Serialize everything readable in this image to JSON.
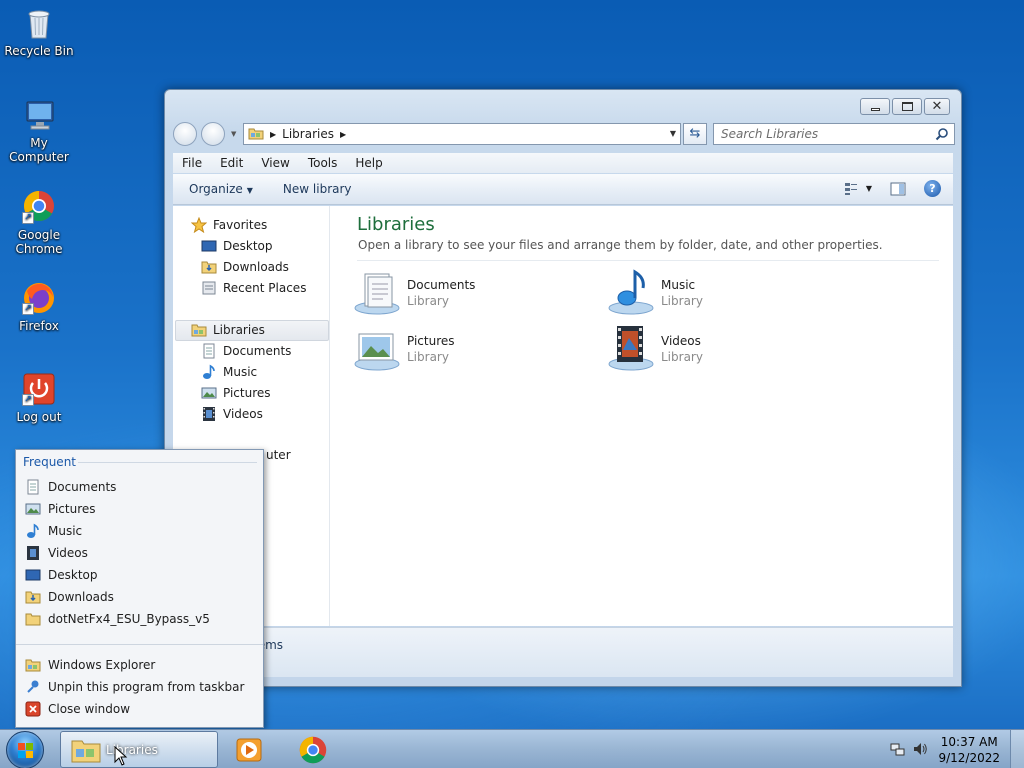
{
  "desktop": {
    "icons": [
      {
        "label": "Recycle Bin",
        "icon": "recycle-bin-icon"
      },
      {
        "label": "My Computer",
        "icon": "computer-icon"
      },
      {
        "label": "Google Chrome",
        "icon": "chrome-icon"
      },
      {
        "label": "Firefox",
        "icon": "firefox-icon"
      },
      {
        "label": "Log out",
        "icon": "log-out-icon"
      }
    ]
  },
  "window": {
    "address": "Libraries",
    "search_placeholder": "Search Libraries",
    "menu": [
      "File",
      "Edit",
      "View",
      "Tools",
      "Help"
    ],
    "toolbar": {
      "organize": "Organize",
      "new_library": "New library"
    },
    "nav": {
      "favorites": "Favorites",
      "desktop": "Desktop",
      "downloads": "Downloads",
      "recent_places": "Recent Places",
      "libraries": "Libraries",
      "documents": "Documents",
      "music": "Music",
      "pictures": "Pictures",
      "videos": "Videos",
      "computer_partial": "uter"
    },
    "content": {
      "title": "Libraries",
      "subtitle": "Open a library to see your files and arrange them by folder, date, and other properties.",
      "libraries": [
        {
          "name": "Documents",
          "type": "Library"
        },
        {
          "name": "Music",
          "type": "Library"
        },
        {
          "name": "Pictures",
          "type": "Library"
        },
        {
          "name": "Videos",
          "type": "Library"
        }
      ]
    },
    "details_partial": "tems"
  },
  "jumplist": {
    "header": "Frequent",
    "frequent": [
      "Documents",
      "Pictures",
      "Music",
      "Videos",
      "Desktop",
      "Downloads",
      "dotNetFx4_ESU_Bypass_v5"
    ],
    "tasks": [
      "Windows Explorer",
      "Unpin this program from taskbar",
      "Close window"
    ]
  },
  "taskbar": {
    "active_label": "Libraries",
    "time": "10:37 AM",
    "date": "9/12/2022"
  },
  "colors": {
    "accent": "#1e6e3c",
    "jumplist_header": "#1b58a8"
  }
}
